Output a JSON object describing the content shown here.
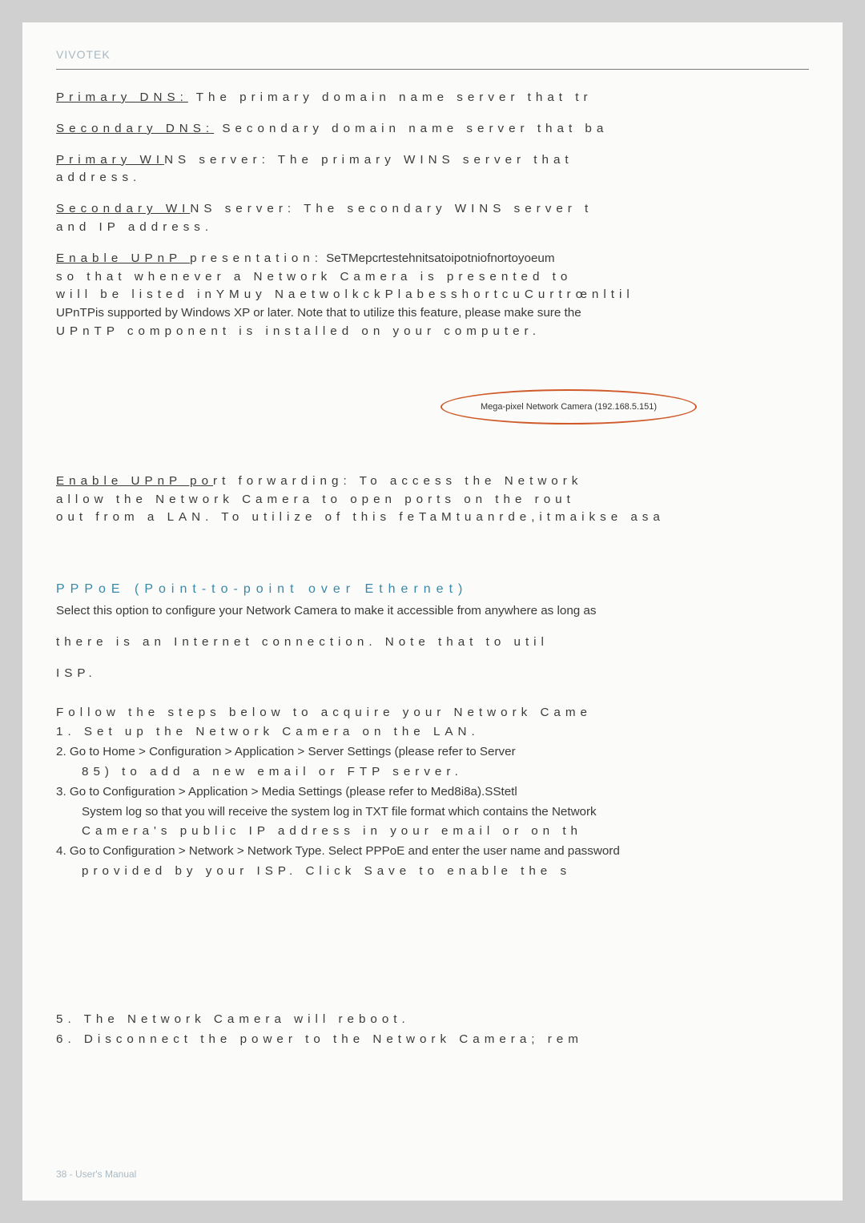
{
  "brand": "VIVOTEK",
  "primary_dns": {
    "label": "Primary DNS:",
    "text": " The primary domain name server that tr"
  },
  "secondary_dns": {
    "label": "Secondary DNS:",
    "text": " Secondary domain name server that ba"
  },
  "primary_wins": {
    "label_u": "Primary WI",
    "label_rest": "NS server:",
    "text": " The primary WINS server that",
    "line2": "address."
  },
  "secondary_wins": {
    "label_u": "Secondary WI",
    "label_rest": "NS server:",
    "text": " The secondary WINS server t",
    "line2": "and IP address."
  },
  "upnp_present": {
    "label": "Enable UPnP ",
    "label_rest": "presentation:",
    "text": " SeTMepcrtestehnitsatoipotniofnortoyoeum",
    "line2": "so that whenever a Network Camera is presented to",
    "line3_a": "will be listed inYMuy NaetwolkckPlabesshortcuCurtrœnltil",
    "line4": "UPnTPis supported by Windows XP or later. Note that to utilize this feature, please make sure the",
    "line5": "UPnTP component is installed on your computer."
  },
  "oval_text": "Mega-pixel Network Camera (192.168.5.151)",
  "upnp_port": {
    "label": "Enable UPnP po",
    "label_rest": "rt forwarding:",
    "text": " To access the Network",
    "line2": "allow the Network Camera to open ports on the rout",
    "line3": "out from a LAN. To utilize of this feTaMtuanrde,itmaikse asa"
  },
  "pppoe_title": "PPPoE (Point-to-point over Ethernet)",
  "pppoe_intro1": "Select this option to configure your Network Camera to make it accessible from anywhere as long as",
  "pppoe_intro2": "there is an Internet connection. Note that to util",
  "pppoe_intro3": "ISP.",
  "steps_intro": "Follow the steps below to acquire your Network Came",
  "step1": "1.  Set up the Network Camera on the LAN.",
  "step2a": "2. Go to Home > Configuration > Application > Server Settings (please refer to Server",
  "step2b": "85) to add a new email or FTP server.",
  "step3a": "3. Go to Configuration > Application > Media Settings (please refer to Med8i8a).SStetl",
  "step3b": "System log so that you will receive the system log in TXT file format which contains the Network",
  "step3c": "Camera's public IP address in your email or on th",
  "step4a": "4. Go to Configuration > Network > Network Type. Select PPPoE and enter the user name and password",
  "step4b": "provided by your ISP. Click Save to enable the s",
  "step5": "5.  The Network Camera will reboot.",
  "step6": "6. Disconnect the power to the Network Camera; rem",
  "footer": "38 - User's Manual"
}
